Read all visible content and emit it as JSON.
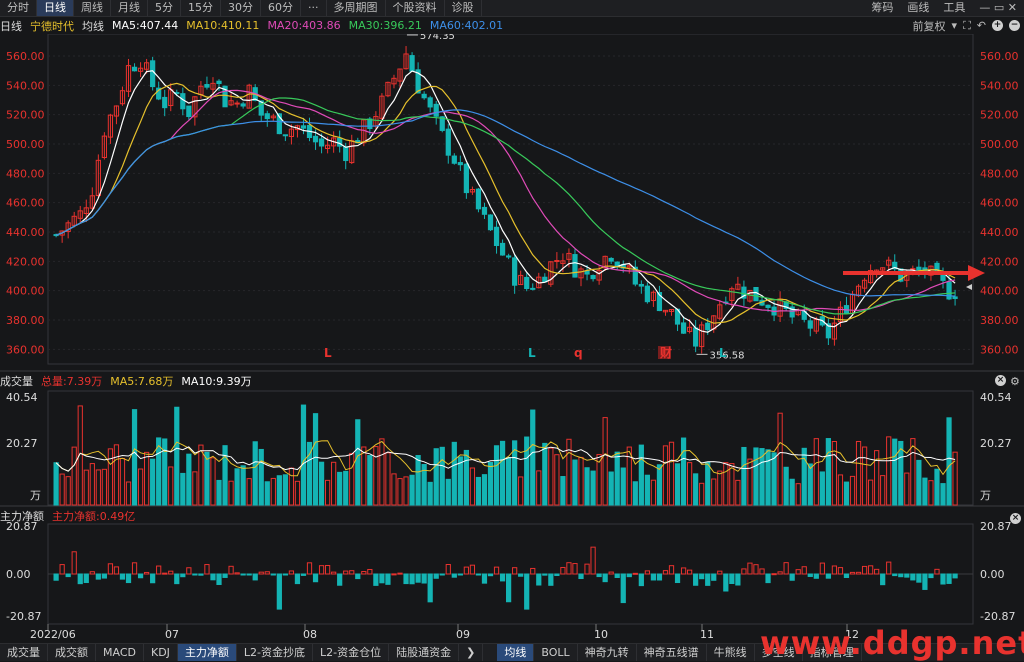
{
  "topbar": {
    "items": [
      "分时",
      "日线",
      "周线",
      "月线",
      "5分",
      "15分",
      "30分",
      "60分",
      "···",
      "多周期图",
      "个股资料",
      "诊股"
    ],
    "active": 1,
    "right": [
      "筹码",
      "画线",
      "工具"
    ]
  },
  "info": {
    "period": "日线",
    "stock": "宁德时代",
    "avg": "均线",
    "ma5": "MA5:407.44",
    "ma10": "MA10:410.11",
    "ma20": "MA20:403.86",
    "ma30": "MA30:396.21",
    "ma60": "MA60:402.01",
    "adjust": "前复权"
  },
  "colors": {
    "up": "#e8322e",
    "down": "#14b4b4",
    "ma5": "#ffffff",
    "ma10": "#e6c02c",
    "ma20": "#e04bb8",
    "ma30": "#38c95a",
    "ma60": "#3d8fe8",
    "arrow": "#e8322e"
  },
  "price_axis": {
    "ticks": [
      "560.00",
      "540.00",
      "520.00",
      "500.00",
      "480.00",
      "460.00",
      "440.00",
      "420.00",
      "400.00",
      "380.00",
      "360.00"
    ],
    "high_label": "574.35",
    "low_label": "356.58",
    "markers": [
      "L",
      "L",
      "q",
      "财",
      "L"
    ]
  },
  "volume": {
    "title": "成交量",
    "total": "总量:7.39万",
    "ma5": "MA5:7.68万",
    "ma10": "MA10:9.39万",
    "ticks": [
      "40.54",
      "20.27"
    ],
    "unit": "万"
  },
  "flow": {
    "title": "主力净额",
    "value": "主力净额:0.49亿",
    "ticks": [
      "20.87",
      "0.00",
      "-20.87"
    ]
  },
  "x_axis": {
    "labels": [
      "2022/06",
      "07",
      "08",
      "09",
      "10",
      "11",
      "12"
    ]
  },
  "bottombar": {
    "left": [
      "成交量",
      "成交额",
      "MACD",
      "KDJ",
      "主力净额",
      "L2-资金抄底",
      "L2-资金仓位",
      "陆股通资金"
    ],
    "left_active": 4,
    "right": [
      "均线",
      "BOLL",
      "神奇九转",
      "神奇五线谱",
      "牛熊线",
      "多空线",
      "指标管理"
    ],
    "right_active": 0
  },
  "watermark": "www.ddgp.net",
  "chart_data": {
    "type": "candlestick",
    "x": [
      "2022/06",
      "07",
      "08",
      "09",
      "10",
      "11",
      "12"
    ],
    "ylim": [
      350,
      575
    ],
    "price_ticks": [
      560,
      540,
      520,
      500,
      480,
      460,
      440,
      420,
      400,
      380,
      360
    ],
    "high": 574.35,
    "low": 356.58,
    "close_path": [
      438,
      445,
      452,
      470,
      510,
      528,
      552,
      558,
      540,
      528,
      534,
      522,
      540,
      548,
      530,
      528,
      536,
      520,
      516,
      510,
      512,
      505,
      498,
      502,
      495,
      505,
      515,
      528,
      545,
      562,
      540,
      522,
      505,
      490,
      470,
      455,
      440,
      425,
      410,
      402,
      408,
      418,
      425,
      416,
      410,
      420,
      426,
      418,
      405,
      398,
      392,
      384,
      372,
      365,
      378,
      392,
      405,
      400,
      396,
      392,
      388,
      382,
      378,
      374,
      370,
      384,
      398,
      412,
      420,
      416,
      410,
      412,
      414,
      406,
      400
    ],
    "ma5": 407.44,
    "ma10": 410.11,
    "ma20": 403.86,
    "ma30": 396.21,
    "ma60": 402.01,
    "volume_ticks": [
      40.54,
      20.27
    ],
    "volume_total": "7.39万",
    "flow_ticks": [
      20.87,
      0.0,
      -20.87
    ]
  }
}
